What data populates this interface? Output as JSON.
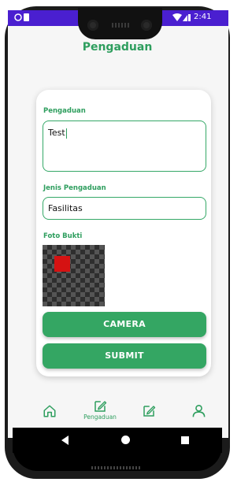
{
  "status_bar": {
    "time": "2:41"
  },
  "page": {
    "title": "Pengaduan"
  },
  "form": {
    "pengaduan_label": "Pengaduan",
    "pengaduan_value": "Test",
    "jenis_label": "Jenis Pengaduan",
    "jenis_value": "Fasilitas",
    "foto_label": "Foto Bukti",
    "camera_button": "CAMERA",
    "submit_button": "SUBMIT"
  },
  "bottom_nav": {
    "items": [
      {
        "icon": "home-icon",
        "label": ""
      },
      {
        "icon": "edit-icon",
        "label": "Pengaduan"
      },
      {
        "icon": "edit-icon",
        "label": ""
      },
      {
        "icon": "person-icon",
        "label": ""
      }
    ]
  },
  "colors": {
    "accent": "#34a663",
    "statusbar": "#4a1fd0"
  }
}
